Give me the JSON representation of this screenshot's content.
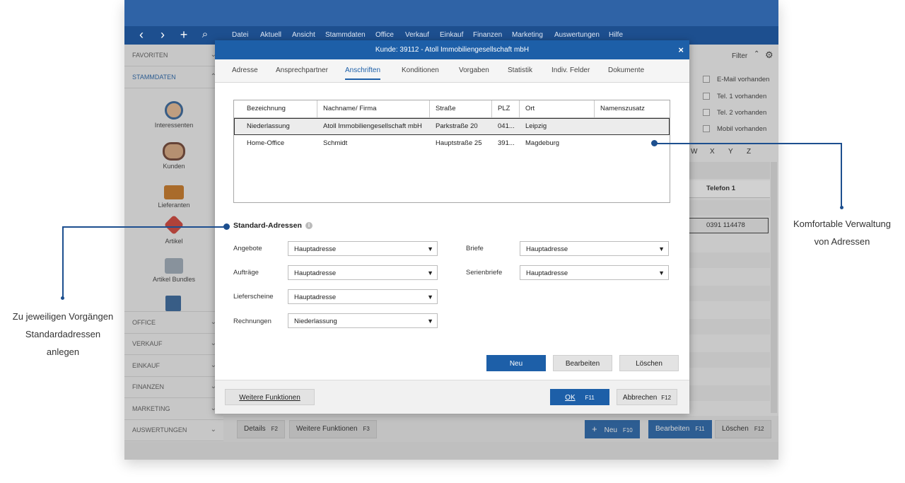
{
  "menu": [
    "Datei",
    "Aktuell",
    "Ansicht",
    "Stammdaten",
    "Office",
    "Verkauf",
    "Einkauf",
    "Finanzen",
    "Marketing",
    "Auswertungen",
    "Hilfe"
  ],
  "nav_icons": {
    "back": "‹",
    "forward": "›",
    "add": "+",
    "search": "⌕"
  },
  "sidebar": {
    "favoriten": "FAVORITEN",
    "stammdaten": "STAMMDATEN",
    "items": [
      "Interessenten",
      "Kunden",
      "Lieferanten",
      "Artikel",
      "Artikel Bundles"
    ],
    "sections": [
      "OFFICE",
      "VERKAUF",
      "EINKAUF",
      "FINANZEN",
      "MARKETING",
      "AUSWERTUNGEN"
    ]
  },
  "background": {
    "filter": "Filter",
    "checks": [
      "E-Mail vorhanden",
      "Tel. 1 vorhanden",
      "Tel. 2 vorhanden",
      "Mobil vorhanden"
    ],
    "letters": [
      "W",
      "X",
      "Y",
      "Z"
    ],
    "col_header": "Telefon 1",
    "phone": "0391 114478"
  },
  "toolbar": {
    "details": "Details",
    "details_key": "F2",
    "weitere": "Weitere Funktionen",
    "weitere_key": "F3",
    "neu": "Neu",
    "neu_key": "F10",
    "bearbeiten": "Bearbeiten",
    "bearbeiten_key": "F11",
    "loeschen": "Löschen",
    "loeschen_key": "F12"
  },
  "dialog": {
    "title": "Kunde: 39112 - Atoll Immobiliengesellschaft mbH",
    "close": "×",
    "tabs": [
      "Adresse",
      "Ansprechpartner",
      "Anschriften",
      "Konditionen",
      "Vorgaben",
      "Statistik",
      "Indiv. Felder",
      "Dokumente"
    ],
    "active_tab": "Anschriften",
    "table": {
      "headers": [
        "Bezeichnung",
        "Nachname/ Firma",
        "Straße",
        "PLZ",
        "Ort",
        "Namenszusatz"
      ],
      "rows": [
        [
          "Niederlassung",
          "Atoll Immobiliengesellschaft mbH",
          "Parkstraße 20",
          "041...",
          "Leipzig",
          ""
        ],
        [
          "Home-Office",
          "Schmidt",
          "Hauptstraße 25",
          "391...",
          "Magdeburg",
          ""
        ]
      ]
    },
    "standard_title": "Standard-Adressen",
    "info_icon": "i",
    "fields": {
      "angebote": {
        "label": "Angebote",
        "value": "Hauptadresse"
      },
      "auftraege": {
        "label": "Aufträge",
        "value": "Hauptadresse"
      },
      "lieferscheine": {
        "label": "Lieferscheine",
        "value": "Hauptadresse"
      },
      "rechnungen": {
        "label": "Rechnungen",
        "value": "Niederlassung"
      },
      "briefe": {
        "label": "Briefe",
        "value": "Hauptadresse"
      },
      "serienbriefe": {
        "label": "Serienbriefe",
        "value": "Hauptadresse"
      }
    },
    "buttons": {
      "neu": "Neu",
      "bearbeiten": "Bearbeiten",
      "loeschen": "Löschen"
    },
    "footer": {
      "weitere": "Weitere Funktionen",
      "ok": "OK",
      "ok_key": "F11",
      "abbrechen": "Abbrechen",
      "abbrechen_key": "F12"
    }
  },
  "callouts": {
    "right_line1": "Komfortable Verwaltung",
    "right_line2": "von Adressen",
    "left_line1": "Zu jeweiligen Vorgängen",
    "left_line2": "Standardadressen",
    "left_line3": "anlegen"
  },
  "colors": {
    "accent": "#1d5fa8",
    "titlebar": "#2f63a6",
    "menubar": "#1d4f8f"
  }
}
